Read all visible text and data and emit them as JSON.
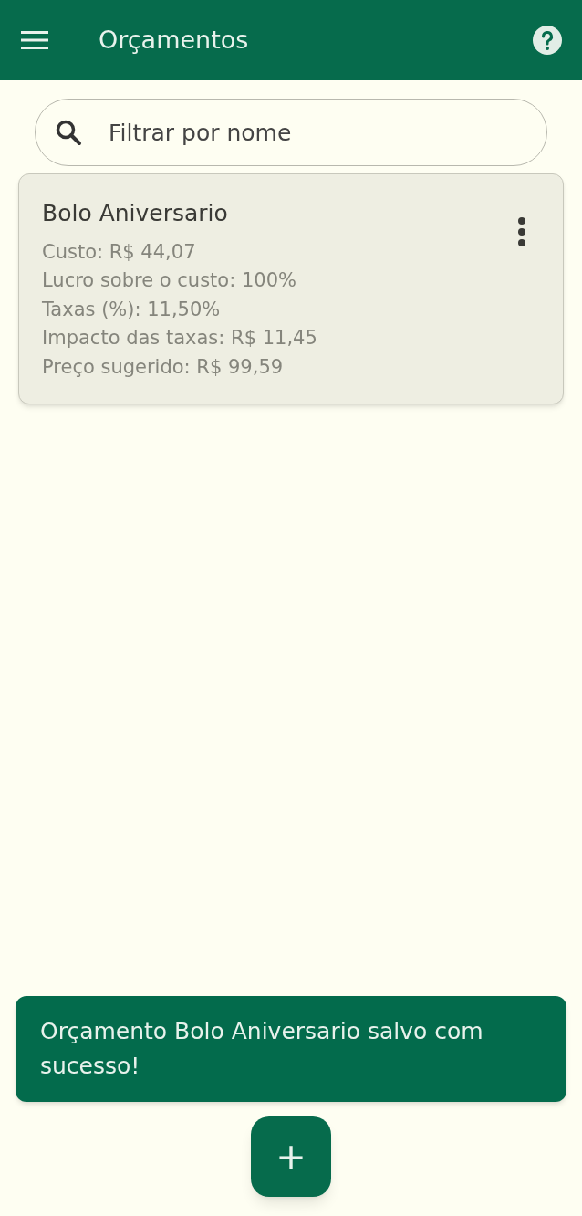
{
  "app_bar": {
    "title": "Orçamentos"
  },
  "search": {
    "placeholder": "Filtrar por nome"
  },
  "cards": [
    {
      "title": "Bolo Aniversario",
      "lines": [
        "Custo: R$ 44,07",
        "Lucro sobre o custo: 100%",
        "Taxas (%): 11,50%",
        "Impacto das taxas: R$ 11,45",
        "Preço sugerido: R$ 99,59"
      ]
    }
  ],
  "snackbar": {
    "message": "Orçamento Bolo Aniversario salvo com sucesso!"
  },
  "fab": {
    "label": "+"
  }
}
